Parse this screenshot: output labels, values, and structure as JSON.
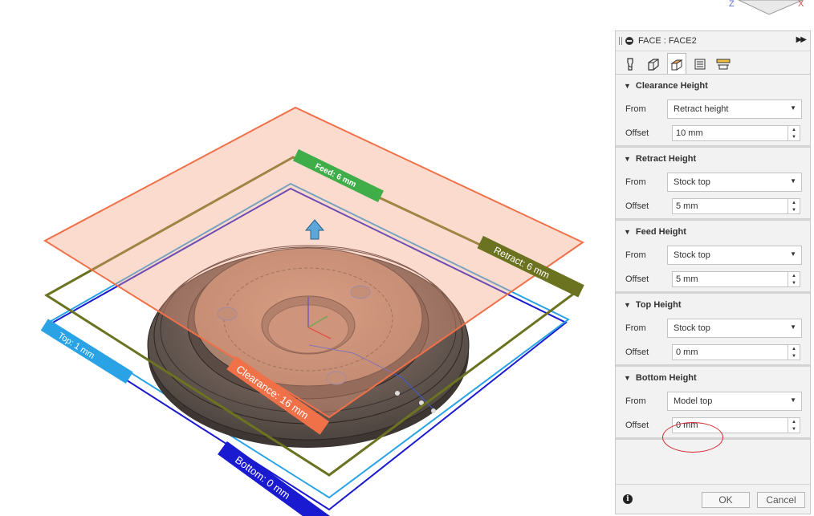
{
  "panel": {
    "title": "FACE : FACE2",
    "tabs": [
      {
        "icon": "tool-icon"
      },
      {
        "icon": "geometry-icon"
      },
      {
        "icon": "heights-icon"
      },
      {
        "icon": "passes-icon"
      },
      {
        "icon": "linking-icon"
      }
    ],
    "sections": [
      {
        "title": "Clearance Height",
        "from_label": "From",
        "from_value": "Retract height",
        "offset_label": "Offset",
        "offset_value": "10 mm"
      },
      {
        "title": "Retract Height",
        "from_label": "From",
        "from_value": "Stock top",
        "offset_label": "Offset",
        "offset_value": "5 mm"
      },
      {
        "title": "Feed Height",
        "from_label": "From",
        "from_value": "Stock top",
        "offset_label": "Offset",
        "offset_value": "5 mm"
      },
      {
        "title": "Top Height",
        "from_label": "From",
        "from_value": "Stock top",
        "offset_label": "Offset",
        "offset_value": "0 mm"
      },
      {
        "title": "Bottom Height",
        "from_label": "From",
        "from_value": "Model top",
        "offset_label": "Offset",
        "offset_value": "0 mm"
      }
    ],
    "ok_label": "OK",
    "cancel_label": "Cancel"
  },
  "viewport": {
    "labels": {
      "clearance": "Clearance: 16 mm",
      "retract": "Retract: 6 mm",
      "feed": "Feed: 6 mm",
      "top": "Top: 1 mm",
      "bottom": "Bottom: 0 mm"
    },
    "viewcube": {
      "left_axis": "Z",
      "right_axis": "X"
    },
    "colors": {
      "clearance": "#f07048",
      "retract": "#6b7320",
      "feed": "#3fae49",
      "top": "#2aa3e6",
      "bottom": "#1a1ad0",
      "annotation": "#d3272e"
    }
  }
}
